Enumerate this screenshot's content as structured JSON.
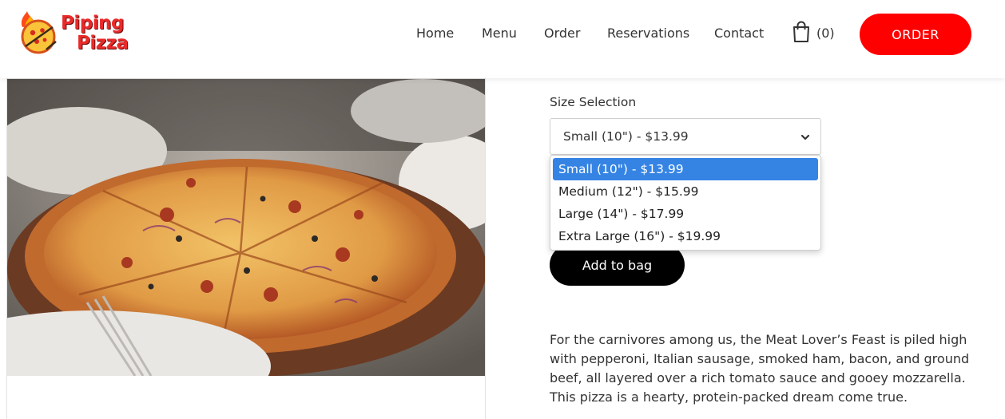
{
  "brand": {
    "line1": "Piping",
    "line2": "Pizza"
  },
  "nav": {
    "items": [
      {
        "label": "Home"
      },
      {
        "label": "Menu"
      },
      {
        "label": "Order"
      },
      {
        "label": "Reservations"
      },
      {
        "label": "Contact"
      }
    ],
    "bag_count": "(0)",
    "order_label": "ORDER"
  },
  "product": {
    "size_label": "Size Selection",
    "selected_size": "Small (10\") - $13.99",
    "size_options": [
      "Small (10\") - $13.99",
      "Medium (12\") - $15.99",
      "Large (14\") - $17.99",
      "Extra Large (16\") - $19.99"
    ],
    "add_label": "Add to bag",
    "description": "For the carnivores among us, the Meat Lover’s Feast is piled high with pepperoni, Italian sausage, smoked ham, bacon, and ground beef, all layered over a rich tomato sauce and gooey mozzarella. This pizza is a hearty, protein-packed dream come true."
  },
  "colors": {
    "accent": "#ff0000",
    "select_highlight": "#3584e4",
    "button_dark": "#000000"
  },
  "icons": {
    "logo": "pizza-flame-logo",
    "bag": "shopping-bag-icon",
    "dropdown": "chevron-down-icon"
  }
}
